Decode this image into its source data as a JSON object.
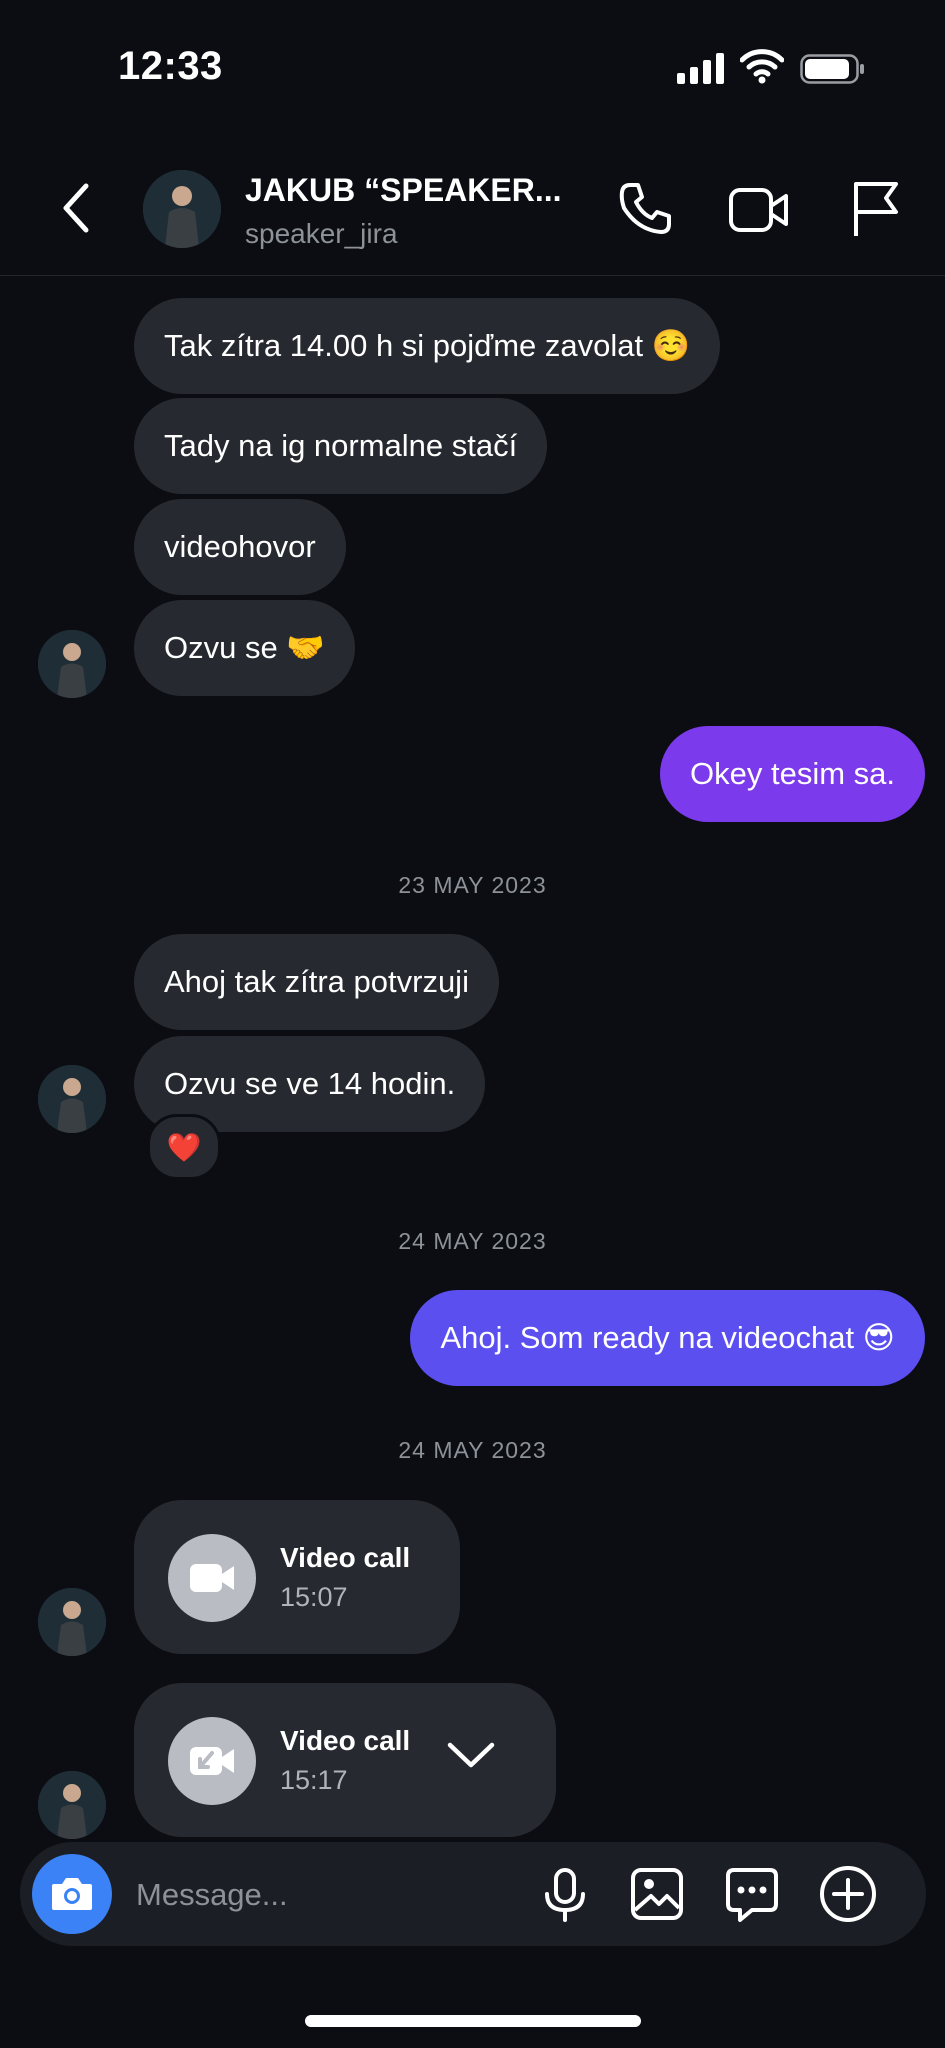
{
  "status_bar": {
    "time": "12:33"
  },
  "header": {
    "name": "JAKUB “SPEAKER...",
    "username": "speaker_jira"
  },
  "messages": [
    {
      "from": "them",
      "text": "Tak zítra 14.00 h si pojďme zavolat ☺️"
    },
    {
      "from": "them",
      "text": "Tady na ig normalne stačí"
    },
    {
      "from": "them",
      "text": "videohovor"
    },
    {
      "from": "them",
      "text": "Ozvu se 🤝"
    },
    {
      "from": "me",
      "text": "Okey tesim sa."
    },
    {
      "date": "23 MAY 2023"
    },
    {
      "from": "them",
      "text": "Ahoj tak zítra potvrzuji"
    },
    {
      "from": "them",
      "text": "Ozvu se ve 14 hodin.",
      "reaction": "❤️"
    },
    {
      "date": "24 MAY 2023"
    },
    {
      "from": "me",
      "text": "Ahoj. Som ready na videochat 😎"
    },
    {
      "date": "24 MAY 2023"
    },
    {
      "from": "them",
      "call": {
        "title": "Video call",
        "time": "15:07",
        "icon": "video-camera-icon"
      }
    },
    {
      "from": "them",
      "call": {
        "title": "Video call",
        "time": "15:17",
        "icon": "incoming-video-call-icon"
      }
    }
  ],
  "composer": {
    "placeholder": "Message..."
  },
  "colors": {
    "background": "#0b0d12",
    "bubble_in": "#26292f",
    "bubble_out_top": "#7c3aed",
    "bubble_out_bottom": "#5b4ff0",
    "camera_button": "#3b82f6"
  }
}
